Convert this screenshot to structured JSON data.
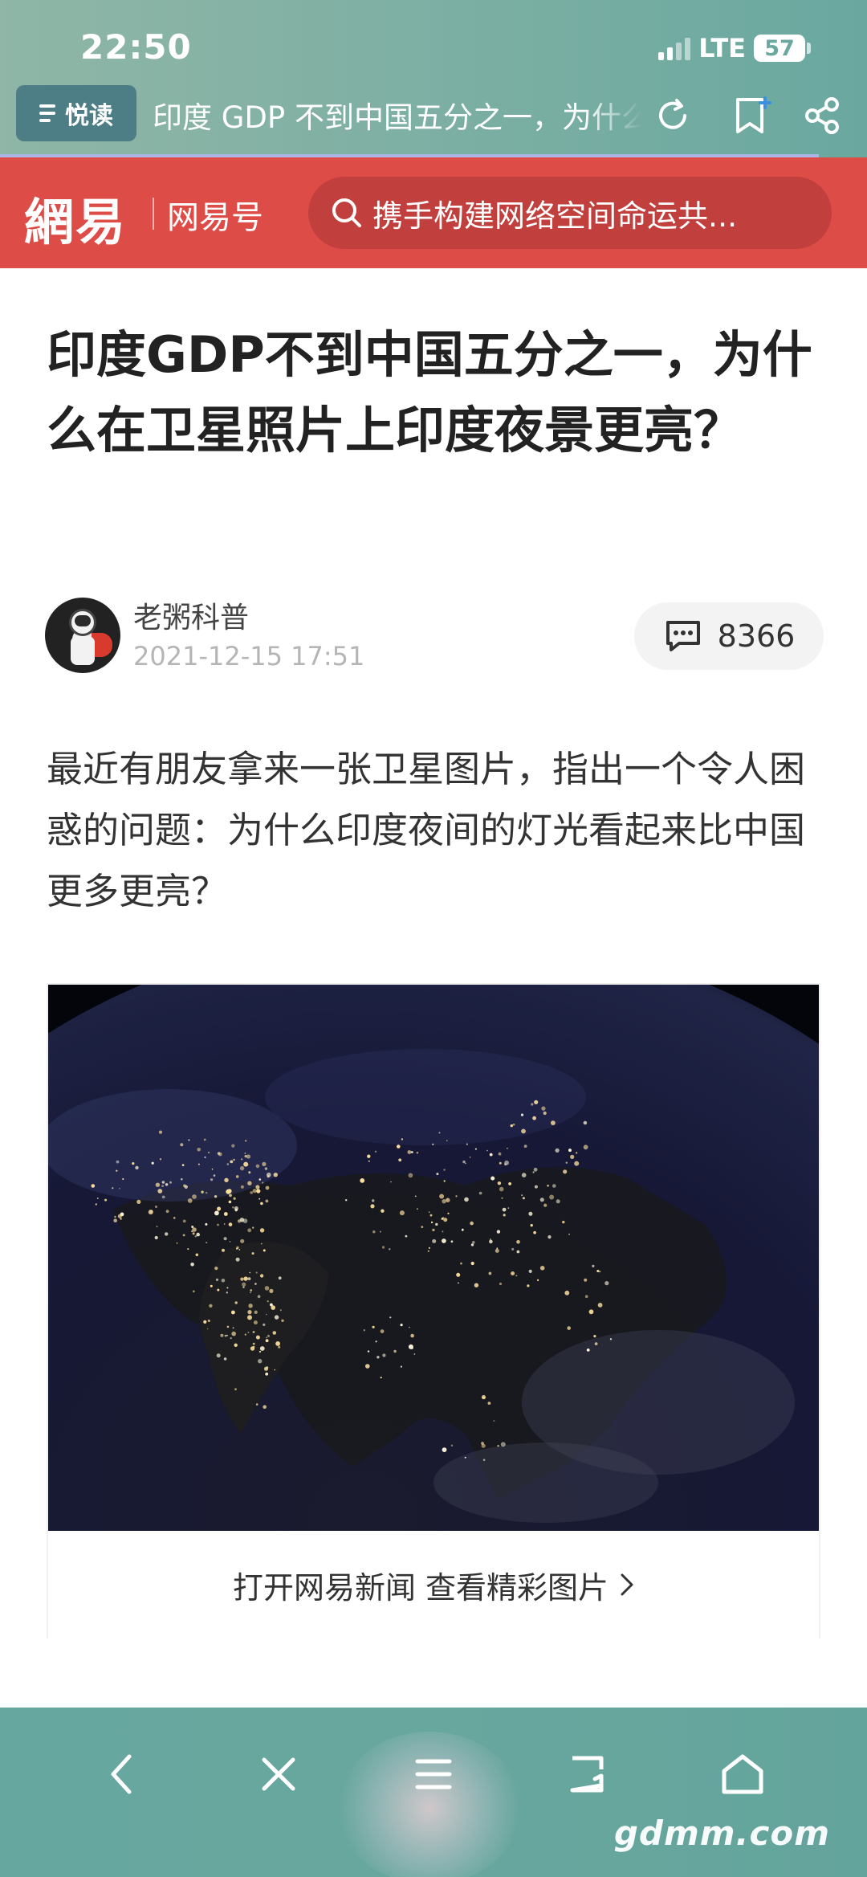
{
  "status_bar": {
    "time": "22:50",
    "network": "LTE",
    "battery": "57"
  },
  "browser_bar": {
    "reader_label": "悦读",
    "page_title": "印度 GDP 不到中国五分之一，为什么在卫星照片上印度夜景更亮？",
    "icons": [
      "menu-icon",
      "refresh-icon",
      "bookmark-add-icon",
      "share-icon"
    ]
  },
  "site_header": {
    "logo": "網易",
    "channel": "网易号",
    "search_placeholder": "携手构建网络空间命运共..."
  },
  "article": {
    "title": "印度GDP不到中国五分之一，为什么在卫星照片上印度夜景更亮？",
    "author": "老粥科普",
    "date": "2021-12-15 17:51",
    "comment_count": "8366",
    "lead": "最近有朋友拿来一张卫星图片，指出一个令人困惑的问题：为什么印度夜间的灯光看起来比中国更多更亮？"
  },
  "image_card": {
    "cta": "打开网易新闻 查看精彩图片"
  },
  "bottom_bar": {
    "icons": [
      "back-icon",
      "close-icon",
      "menu-icon",
      "tabs-icon",
      "home-icon"
    ]
  },
  "watermark": "gdmm.com",
  "colors": {
    "header_red": "#de4c48",
    "chrome_teal": "#6aa89f",
    "title_text": "#222222"
  }
}
